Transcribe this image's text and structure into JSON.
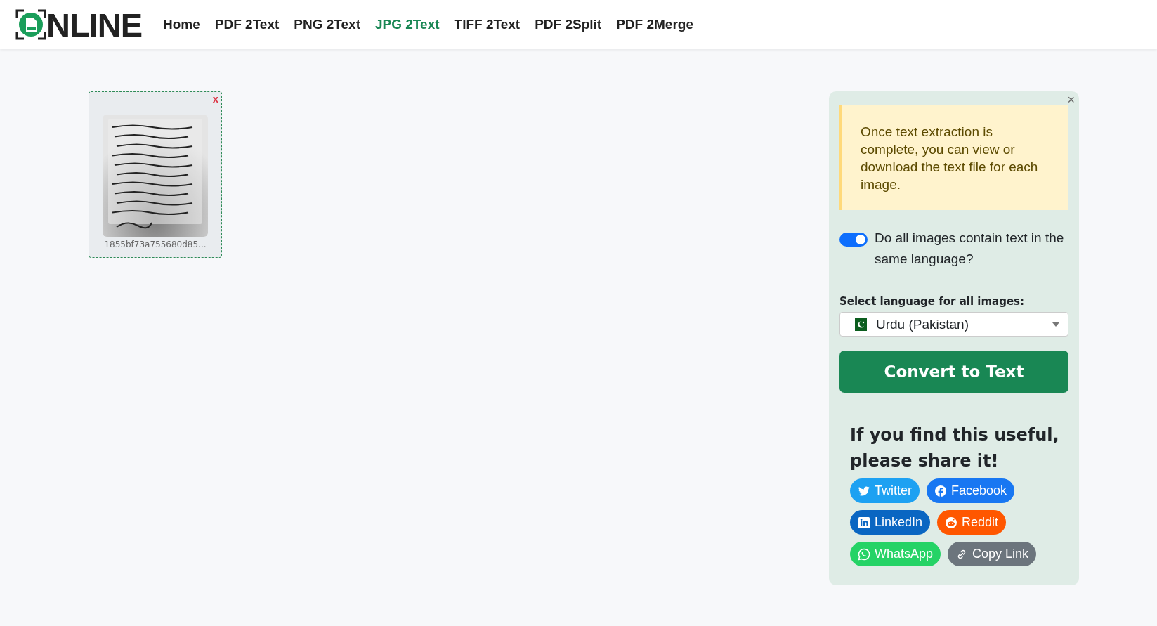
{
  "header": {
    "logo_text": "NLINE",
    "nav": [
      {
        "label": "Home",
        "selected": false
      },
      {
        "label": "PDF 2Text",
        "selected": false
      },
      {
        "label": "PNG 2Text",
        "selected": false
      },
      {
        "label": "JPG 2Text",
        "selected": true
      },
      {
        "label": "TIFF 2Text",
        "selected": false
      },
      {
        "label": "PDF 2Split",
        "selected": false
      },
      {
        "label": "PDF 2Merge",
        "selected": false
      }
    ]
  },
  "uploads": [
    {
      "kind": "picture",
      "remove": "x",
      "filename": "1855bf73a755680d85..."
    }
  ],
  "panel": {
    "close": "×",
    "notice": "Once text extraction is complete, you can view or download the text file for each image.",
    "same_language": {
      "on": true,
      "label": "Do all images contain text in the same language?"
    },
    "language_label": "Select language for all images:",
    "language": "Urdu (Pakistan)",
    "convert_button": "Convert to Text",
    "share_title": "If you find this useful, please share it!",
    "share": [
      {
        "kind": "twitter",
        "label": "Twitter",
        "color": "#1da1f2"
      },
      {
        "kind": "facebook",
        "label": "Facebook",
        "color": "#1877f2"
      },
      {
        "kind": "linkedin",
        "label": "LinkedIn",
        "color": "#0a66c2"
      },
      {
        "kind": "reddit",
        "label": "Reddit",
        "color": "#ff5700"
      },
      {
        "kind": "whatsapp",
        "label": "WhatsApp",
        "color": "#25d366"
      },
      {
        "kind": "link",
        "label": "Copy Link",
        "color": "#6c757d"
      }
    ]
  }
}
